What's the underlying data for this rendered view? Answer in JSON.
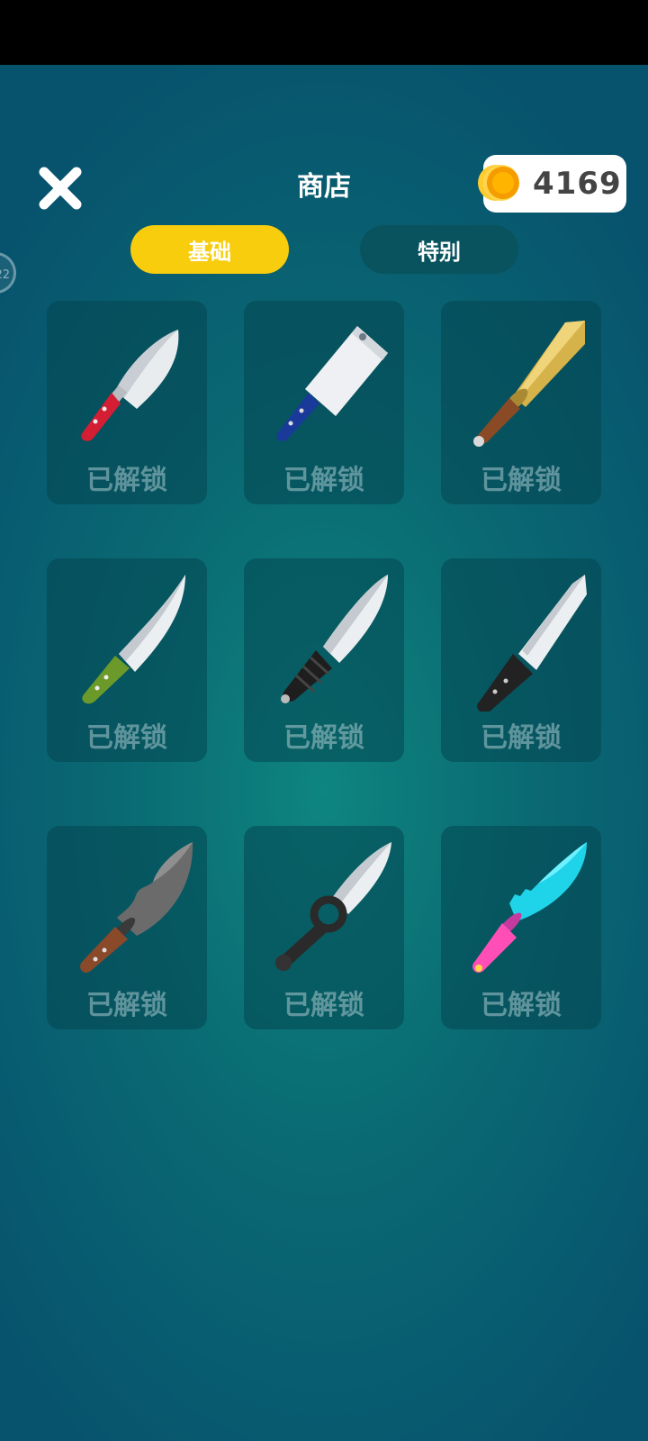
{
  "header": {
    "title": "商店",
    "coins": "4169"
  },
  "side_badge": "22",
  "tabs": [
    {
      "label": "基础",
      "active": true
    },
    {
      "label": "特别",
      "active": false
    }
  ],
  "items": [
    {
      "name": "red-kitchen-knife",
      "status": "已解锁",
      "handle_color": "#d41e34"
    },
    {
      "name": "blue-cleaver",
      "status": "已解锁",
      "handle_color": "#1a3a9a"
    },
    {
      "name": "golden-dagger",
      "status": "已解锁",
      "handle_color": "#8a4a26"
    },
    {
      "name": "green-chef-knife",
      "status": "已解锁",
      "handle_color": "#6b9a2a"
    },
    {
      "name": "black-combat-knife",
      "status": "已解锁",
      "handle_color": "#1e1e1e"
    },
    {
      "name": "black-tanto-knife",
      "status": "已解锁",
      "handle_color": "#222222"
    },
    {
      "name": "brown-machete",
      "status": "已解锁",
      "handle_color": "#8a4a2a"
    },
    {
      "name": "ring-dagger",
      "status": "已解锁",
      "handle_color": "#2a2a2a"
    },
    {
      "name": "cyan-serrated-knife",
      "status": "已解锁",
      "handle_color": "#ff4fb6"
    }
  ],
  "colors": {
    "accent": "#f8cd0e",
    "tab_inactive": "#08535e",
    "background": "#0a6a73"
  }
}
